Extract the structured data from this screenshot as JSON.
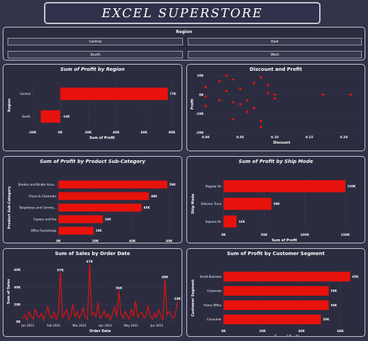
{
  "dashboard": {
    "title": "EXCEL SUPERSTORE"
  },
  "slicer": {
    "title": "Region",
    "options": [
      "Central",
      "East",
      "South",
      "West"
    ]
  },
  "colors": {
    "bar": "#e8120c",
    "background": "#33334a",
    "panel": "#2c2c40",
    "text": "#ffffff"
  },
  "charts": {
    "region": {
      "type": "bar",
      "title": "Sum of Profit by Region",
      "categories": [
        "Central",
        "South"
      ],
      "values": [
        77,
        -14
      ],
      "labels": [
        "77K",
        "-14K"
      ],
      "ticks": [
        "-20K",
        "0K",
        "20K",
        "40K",
        "60K",
        "80K"
      ],
      "tick_values": [
        -20,
        0,
        20,
        40,
        60,
        80
      ],
      "xlim": [
        -20,
        80
      ],
      "xlabel": "Sum of Profit",
      "ylabel": "Region"
    },
    "discount": {
      "type": "scatter",
      "title": "Discount and Profit",
      "x": [
        0.0,
        0.0,
        0.0,
        0.02,
        0.02,
        0.03,
        0.04,
        0.04,
        0.05,
        0.05,
        0.06,
        0.07,
        0.08,
        0.08,
        0.09,
        0.1,
        0.1,
        0.17,
        0.21,
        0.04,
        0.08,
        0.07,
        0.09,
        0.03,
        0.06
      ],
      "y": [
        4,
        -1,
        -6,
        7,
        -3,
        2,
        -13,
        8,
        -5,
        3,
        -9,
        6,
        -17,
        -14,
        1,
        -2,
        0,
        0,
        0,
        -4,
        9,
        -7,
        5,
        10,
        -3
      ],
      "xticks": [
        "0.00",
        "0.05",
        "0.10",
        "0.15",
        "0.20"
      ],
      "xtick_values": [
        0,
        0.05,
        0.1,
        0.15,
        0.2
      ],
      "yticks": [
        "10K",
        "0K",
        "-10K",
        "-20K"
      ],
      "ytick_values": [
        10,
        0,
        -10,
        -20
      ],
      "xlim": [
        0,
        0.22
      ],
      "ylim": [
        -20,
        10
      ],
      "xlabel": "Discount",
      "ylabel": "Profit"
    },
    "subcategory": {
      "type": "bar",
      "title": "Sum of Profit by Product Sub-Category",
      "categories": [
        "Binders and Binder Acce...",
        "Chairs & Chairmats",
        "Telephones and Comme...",
        "Copiers and Fax",
        "Office Furnishings"
      ],
      "values": [
        59,
        49,
        45,
        24,
        19
      ],
      "labels": [
        "59K",
        "49K",
        "45K",
        "24K",
        "19K"
      ],
      "ticks": [
        "0K",
        "20K",
        "40K",
        "60K"
      ],
      "tick_values": [
        0,
        20,
        40,
        60
      ],
      "xlim": [
        0,
        60
      ],
      "xlabel": "Sum of Profit",
      "ylabel": "Product Sub-Category"
    },
    "shipmode": {
      "type": "bar",
      "title": "Sum of Profit by Ship Mode",
      "categories": [
        "Regular Air",
        "Delivery Truck",
        "Express Air"
      ],
      "values": [
        150,
        59,
        16
      ],
      "labels": [
        "150K",
        "59K",
        "16K"
      ],
      "ticks": [
        "0K",
        "50K",
        "100K",
        "150K"
      ],
      "tick_values": [
        0,
        50,
        100,
        150
      ],
      "xlim": [
        0,
        150
      ],
      "xlabel": "Sum of Profit",
      "ylabel": "Ship Mode"
    },
    "sales": {
      "type": "line",
      "title": "Sum of Sales by Order Date",
      "values": [
        4,
        8,
        2,
        12,
        6,
        3,
        15,
        7,
        5,
        10,
        2,
        9,
        18,
        6,
        4,
        11,
        3,
        8,
        57,
        5,
        9,
        14,
        3,
        7,
        20,
        6,
        12,
        4,
        9,
        16,
        5,
        3,
        67,
        8,
        11,
        6,
        22,
        4,
        7,
        13,
        5,
        9,
        2,
        10,
        17,
        6,
        36,
        8,
        4,
        12,
        7,
        3,
        15,
        6,
        24,
        5,
        9,
        11,
        4,
        8,
        19,
        6,
        3,
        10,
        5,
        14,
        7,
        2,
        49,
        8,
        12,
        6,
        4,
        9,
        24
      ],
      "labels": [
        "57K",
        "67K",
        "36K",
        "49K",
        "24K"
      ],
      "ticks_x": [
        "Jan 2015",
        "Feb 2015",
        "Mar 2015",
        "Apr 2015",
        "May 2015",
        "Jun 2015"
      ],
      "ticks_y": [
        "0K",
        "20K",
        "40K",
        "60K"
      ],
      "ytick_values": [
        0,
        20,
        40,
        60
      ],
      "ylim": [
        0,
        70
      ],
      "xlabel": "Order Date",
      "ylabel": "Sum of Sales"
    },
    "segment": {
      "type": "bar",
      "title": "Sum of Profit by Customer Segment",
      "categories": [
        "Small Business",
        "Corporate",
        "Home Office",
        "Consumer"
      ],
      "values": [
        65,
        54,
        54,
        50
      ],
      "labels": [
        "65K",
        "54K",
        "54K",
        "50K"
      ],
      "ticks": [
        "0K",
        "20K",
        "40K",
        "60K"
      ],
      "tick_values": [
        0,
        20,
        40,
        60
      ],
      "xlim": [
        0,
        65
      ],
      "xlabel": "Sum of Profit",
      "ylabel": "Customer Segment"
    }
  }
}
